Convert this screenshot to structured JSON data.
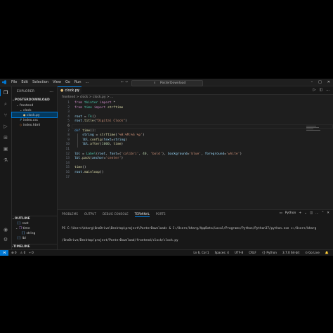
{
  "menu": [
    "File",
    "Edit",
    "Selection",
    "View",
    "Go",
    "Run",
    "..."
  ],
  "command_center": {
    "label": "PosterDownload"
  },
  "nav_arrows": "← →",
  "window_controls": [
    "–",
    "□",
    "✕"
  ],
  "sidebar": {
    "title": "EXPLORER",
    "more": "...",
    "project": "POSTERDOWNLOAD",
    "tree": [
      {
        "label": "frontend",
        "icon": "chevron-down-icon",
        "glyph": "⌄"
      },
      {
        "label": "clock",
        "icon": "chevron-down-icon",
        "glyph": "⌄"
      },
      {
        "label": "clock.py",
        "icon": "python-file-icon",
        "glyph": "●"
      },
      {
        "label": "index.css",
        "icon": "css-file-icon",
        "glyph": "#"
      },
      {
        "label": "index.html",
        "icon": "html-file-icon",
        "glyph": "◇"
      }
    ],
    "outline_title": "OUTLINE",
    "outline": [
      {
        "label": "root",
        "glyph": "[ ]"
      },
      {
        "label": "time",
        "glyph": "⌄"
      },
      {
        "label": "string",
        "glyph": "[ ]"
      },
      {
        "label": "lbl",
        "glyph": "[ ]"
      }
    ],
    "timeline_title": "TIMELINE"
  },
  "editor": {
    "tab_label": "clock.py",
    "breadcrumb": "frontend > clock > clock.py > ...",
    "actions": [
      "▷",
      "◫",
      "..."
    ],
    "lines": [
      {
        "n": "1",
        "html": "<span class=\"k\">from</span> <span class=\"c\">tkinter</span> <span class=\"k\">import</span> *"
      },
      {
        "n": "2",
        "html": "<span class=\"k\">from</span> <span class=\"c\">time</span> <span class=\"k\">import</span> <span class=\"f\">strftime</span>"
      },
      {
        "n": "3",
        "html": ""
      },
      {
        "n": "4",
        "html": "<span class=\"v\">root</span> = <span class=\"c\">Tk</span>()"
      },
      {
        "n": "5",
        "html": "<span class=\"v\">root</span>.<span class=\"f\">title</span>(<span class=\"s\">\"Digital Clock\"</span>)"
      },
      {
        "n": "6",
        "html": ""
      },
      {
        "n": "7",
        "html": "<span class=\"kb\">def</span> <span class=\"f\">time</span>():"
      },
      {
        "n": "8",
        "html": "    <span class=\"v\">string</span> = <span class=\"f\">strftime</span>(<span class=\"s\">'%H:%M:%S %p'</span>)"
      },
      {
        "n": "9",
        "html": "    <span class=\"v\">lbl</span>.<span class=\"f\">config</span>(<span class=\"v\">text</span>=<span class=\"v\">string</span>)"
      },
      {
        "n": "10",
        "html": "    <span class=\"v\">lbl</span>.<span class=\"f\">after</span>(<span class=\"n\">1000</span>, <span class=\"f\">time</span>)"
      },
      {
        "n": "11",
        "html": ""
      },
      {
        "n": "12",
        "html": "<span class=\"v\">lbl</span> = <span class=\"c\">Label</span>(<span class=\"v\">root</span>, <span class=\"v\">font</span>=(<span class=\"s\">'calibri'</span>, <span class=\"n\">40</span>, <span class=\"s\">'bold'</span>), <span class=\"v\">background</span>=<span class=\"s\">'blue'</span>, <span class=\"v\">foreground</span>=<span class=\"s\">'white'</span>)"
      },
      {
        "n": "13",
        "html": "<span class=\"v\">lbl</span>.<span class=\"f\">pack</span>(<span class=\"v\">anchor</span>=<span class=\"s\">'center'</span>)"
      },
      {
        "n": "14",
        "html": ""
      },
      {
        "n": "15",
        "html": "<span class=\"f\">time</span>()"
      },
      {
        "n": "16",
        "html": "<span class=\"v\">root</span>.<span class=\"f\">mainloop</span>()"
      },
      {
        "n": "17",
        "html": ""
      }
    ]
  },
  "panel": {
    "tabs": [
      "PROBLEMS",
      "OUTPUT",
      "DEBUG CONSOLE",
      "TERMINAL",
      "PORTS"
    ],
    "active_tab": "TERMINAL",
    "shell": "Python",
    "actions": [
      "+",
      "⌄",
      "◫",
      "🗑",
      "...",
      "⌃",
      "✕"
    ],
    "terminal_lines": [
      "PS C:\\Users\\bharg\\OneDrive\\Desktop\\project\\PosterDownload> & C:/Users/bharg/AppData/Local/Programs/Python/Python37/python.exe c:/Users/bharg",
      "/OneDrive/Desktop/project/PosterDownload/frontend/clock/clock.py"
    ]
  },
  "status": {
    "left": [
      "⊗ 0",
      "⚠ 0",
      "⑂ 0"
    ],
    "right": [
      "Ln 6, Col 1",
      "Spaces: 4",
      "UTF-8",
      "CRLF",
      "{} Python",
      "3.7.0 64-bit",
      "⊙ Go Live",
      "🔔"
    ]
  }
}
